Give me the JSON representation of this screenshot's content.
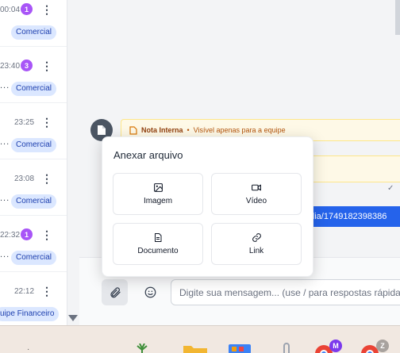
{
  "conversations": [
    {
      "time": "00:04",
      "badge": "1",
      "preview": "",
      "tag": "Comercial"
    },
    {
      "time": "23:40",
      "badge": "3",
      "preview": "...",
      "tag": "Comercial"
    },
    {
      "time": "23:25",
      "badge": "",
      "preview": "...",
      "tag": "Comercial"
    },
    {
      "time": "23:08",
      "badge": "",
      "preview": "...",
      "tag": "Comercial"
    },
    {
      "time": "22:32",
      "badge": "1",
      "preview": "...",
      "tag": "Comercial"
    },
    {
      "time": "22:12",
      "badge": "",
      "preview": "",
      "tag": "uipe Financeiro"
    }
  ],
  "chat": {
    "note_title": "Nota Interna",
    "note_dot": "•",
    "note_subtitle": "Visível apenas para a equipe",
    "link_text": "edia/1749182398386",
    "check_mark": "✓"
  },
  "attach_popup": {
    "title": "Anexar arquivo",
    "options": [
      {
        "label": "Imagem",
        "icon": "image-icon"
      },
      {
        "label": "Vídeo",
        "icon": "video-icon"
      },
      {
        "label": "Documento",
        "icon": "document-icon"
      },
      {
        "label": "Link",
        "icon": "link-icon"
      }
    ]
  },
  "composer": {
    "placeholder": "Digite sua mensagem... (use / para respostas rápidas)"
  },
  "taskbar": {
    "chrome_profile_1": "M",
    "chrome_profile_2": "Z"
  },
  "colors": {
    "badge": "#a855f7",
    "tag_bg": "#dbe7ff",
    "accent": "#2563eb",
    "note_bg": "#fef9e7"
  }
}
